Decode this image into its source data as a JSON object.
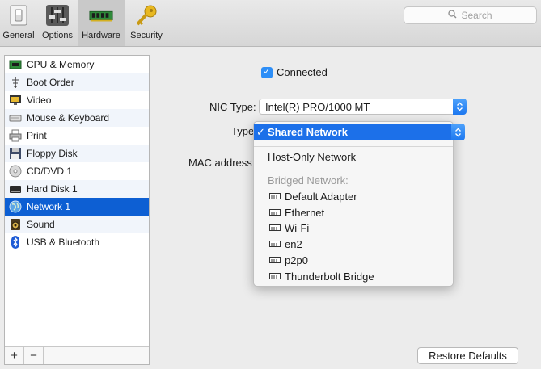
{
  "toolbar": {
    "items": [
      {
        "label": "General",
        "icon": "switch-icon"
      },
      {
        "label": "Options",
        "icon": "sliders-icon"
      },
      {
        "label": "Hardware",
        "icon": "memory-chip-icon",
        "active": true
      },
      {
        "label": "Security",
        "icon": "key-icon"
      }
    ],
    "search_placeholder": "Search"
  },
  "sidebar": {
    "items": [
      {
        "label": "CPU & Memory",
        "icon": "chip-icon"
      },
      {
        "label": "Boot Order",
        "icon": "boot-order-icon"
      },
      {
        "label": "Video",
        "icon": "monitor-icon"
      },
      {
        "label": "Mouse & Keyboard",
        "icon": "keyboard-icon"
      },
      {
        "label": "Print",
        "icon": "printer-icon"
      },
      {
        "label": "Floppy Disk",
        "icon": "floppy-icon"
      },
      {
        "label": "CD/DVD 1",
        "icon": "cd-icon"
      },
      {
        "label": "Hard Disk 1",
        "icon": "hard-disk-icon"
      },
      {
        "label": "Network 1",
        "icon": "globe-icon",
        "selected": true
      },
      {
        "label": "Sound",
        "icon": "speaker-icon"
      },
      {
        "label": "USB & Bluetooth",
        "icon": "bluetooth-icon"
      }
    ],
    "add_label": "+",
    "remove_label": "−"
  },
  "network": {
    "connected_label": "Connected",
    "connected_checked": true,
    "nic_type_label": "NIC Type:",
    "nic_type_value": "Intel(R) PRO/1000 MT",
    "type_label": "Type",
    "mac_label": "MAC address"
  },
  "type_menu": {
    "selected": "Shared Network",
    "check": "✓",
    "host_only": "Host-Only Network",
    "bridged_header": "Bridged Network:",
    "bridged_items": [
      "Default Adapter",
      "Ethernet",
      "Wi-Fi",
      "en2",
      "p2p0",
      "Thunderbolt Bridge"
    ]
  },
  "footer": {
    "restore_label": "Restore Defaults"
  },
  "colors": {
    "accent": "#1c70e9",
    "selection": "#0d5fd3",
    "checkbox": "#2d8ef7"
  }
}
